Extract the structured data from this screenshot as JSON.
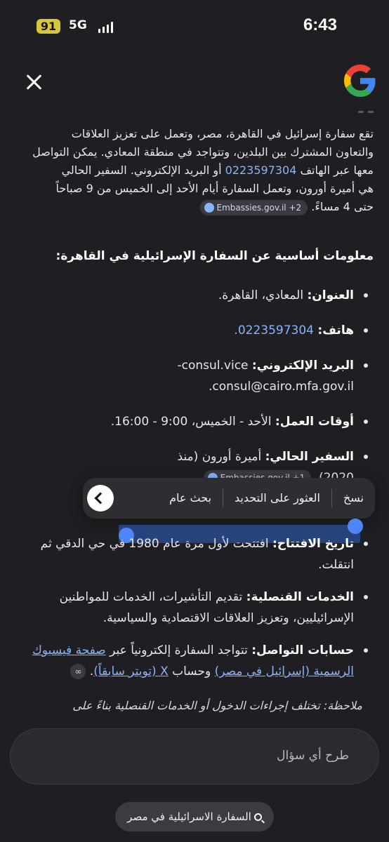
{
  "status": {
    "battery": "91",
    "network": "5G",
    "time": "6:43"
  },
  "intro": {
    "p1": "تقع سفارة إسرائيل في القاهرة، مصر، وتعمل على تعزيز العلاقات",
    "p2": "والتعاون المشترك بين البلدين، وتتواجد في منطقة المعادي. يمكن التواصل",
    "p3a": "معها عبر الهاتف ",
    "phone": "0223597304",
    "p3b": " أو البريد الإلكتروني. السفير الحالي",
    "p4": "هي أميرة أورون، وتعمل السفارة أيام الأحد إلى الخميس من 9 صباحاً",
    "p5": "حتى 4 مساءً.",
    "source": "Embassies.gov.il +2"
  },
  "heading": "معلومات أساسية عن السفارة الإسرائيلية في القاهرة:",
  "items": {
    "address_label": "العنوان:",
    "address_value": "المعادي، القاهرة.",
    "phone_label": "هاتف:",
    "phone_value": "0223597304.",
    "email_label": "البريد الإلكتروني:",
    "email_value": "consul.vice-",
    "email_value2": "consul@cairo.mfa.gov.il.",
    "hours_label": "أوقات العمل:",
    "hours_value": "الأحد - الخميس، 9:00 - 16:00.",
    "amb_label": "السفير الحالي:",
    "amb_value": "أميرة أورون (منذ",
    "amb_value2": "2020).",
    "amb_source": "Embassies.gov.il +1",
    "open_label": "تاريخ الافتتاح:",
    "open_value": "افتتحت لأول مرة عام 1980",
    "open_value_rest": " في حي الدقي ثم",
    "open_value2": "انتقلت.",
    "consular_label": "الخدمات القنصلية:",
    "consular_value": "تقديم التأشيرات، الخدمات للمواطنين",
    "consular_value2": "الإسرائيليين، وتعزيز العلاقات الاقتصادية والسياسية.",
    "social_label": "حسابات التواصل:",
    "social_value": "تتواجد السفارة إلكترونياً عبر ",
    "social_link1": "صفحة فيسبوك",
    "social_link1b": "الرسمية (إسرائيل في مصر)",
    "social_mid": " وحساب ",
    "social_link2": "X (تويتر سابقاً)",
    "social_end": "."
  },
  "popup": {
    "copy": "نسخ",
    "find": "العثور على التحديد",
    "search": "بحث عام"
  },
  "note": "ملاحظة: تختلف إجراءات الدخول أو الخدمات القنصلية بناءً على",
  "ask_placeholder": "طرح أي سؤال",
  "query_pill": "السفارة الاسرائيلية في مصر"
}
